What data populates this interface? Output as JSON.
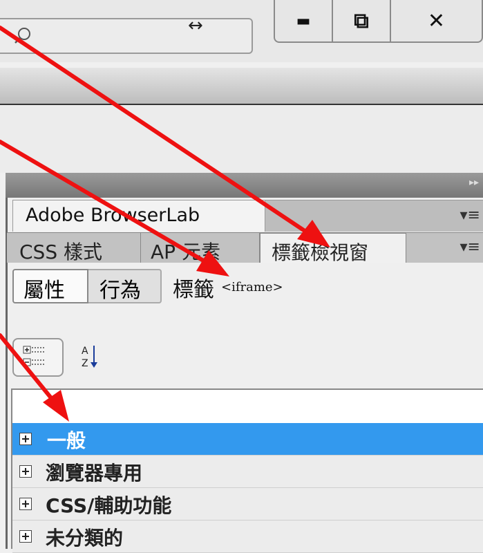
{
  "window": {
    "minimize_glyph": "▬",
    "restore_glyph": "⧉",
    "close_glyph": "✕",
    "resize_glyph": "↔"
  },
  "panel": {
    "browserlab_tab": "Adobe BrowserLab",
    "tabs": [
      "CSS 樣式",
      "AP 元素",
      "標籤檢視窗"
    ],
    "active_tab": "標籤檢視窗",
    "menu_glyph": "▾≡",
    "collapse_glyph": "▸▸"
  },
  "toolbar": {
    "attributes_label": "屬性",
    "behaviors_label": "行為",
    "tag_label": "標籤",
    "tag_value": "<iframe>"
  },
  "categories": [
    {
      "label": "一般",
      "selected": true
    },
    {
      "label": "瀏覽器專用",
      "selected": false
    },
    {
      "label": "CSS/輔助功能",
      "selected": false
    },
    {
      "label": "未分類的",
      "selected": false
    }
  ],
  "colors": {
    "selection": "#3399ee",
    "annotation_arrow": "#ee1111"
  }
}
